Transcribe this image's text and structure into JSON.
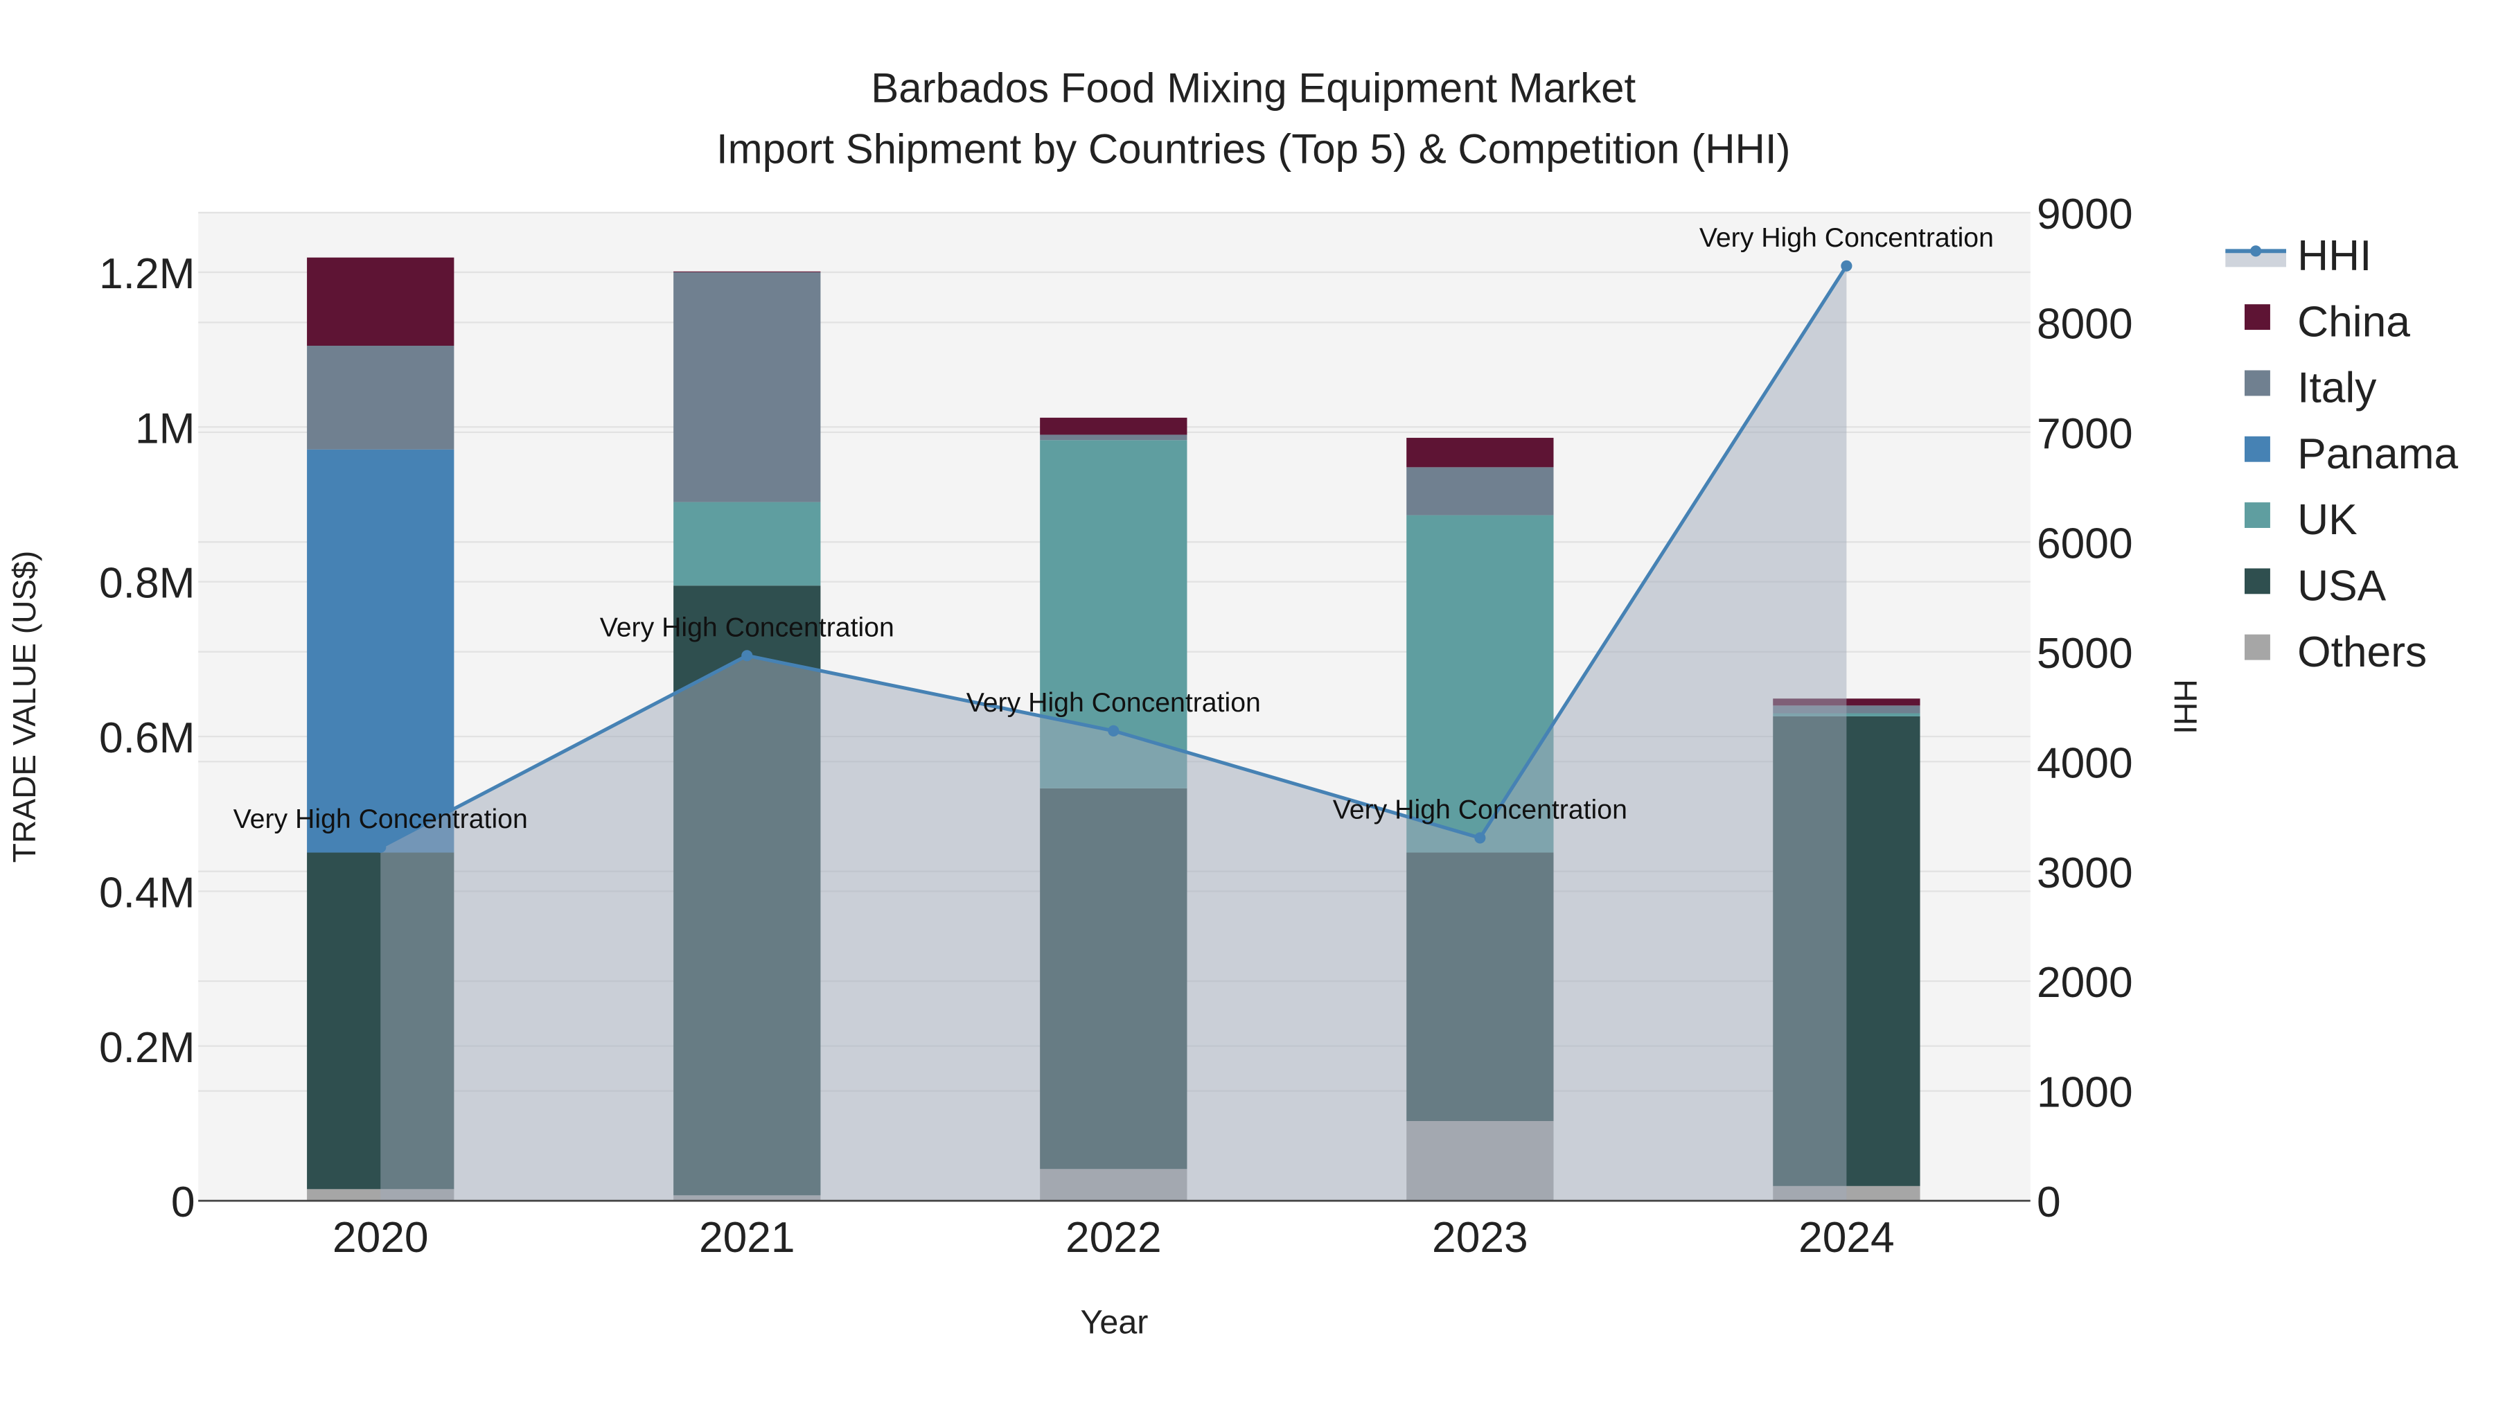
{
  "chart_data": {
    "type": "bar",
    "stacked": true,
    "title": "Barbados Food Mixing Equipment Market",
    "subtitle": "Import Shipment by Countries (Top 5) & Competition (HHI)",
    "xlabel": "Year",
    "ylabel": "TRADE VALUE (US$)",
    "y2label": "HHI",
    "categories": [
      "2020",
      "2021",
      "2022",
      "2023",
      "2024"
    ],
    "ylim": [
      0,
      1277000
    ],
    "y2lim": [
      0,
      9000
    ],
    "yticks": [
      0,
      200000,
      400000,
      600000,
      800000,
      1000000,
      1200000
    ],
    "ytick_labels": [
      "0",
      "0.2M",
      "0.4M",
      "0.6M",
      "0.8M",
      "1M",
      "1.2M"
    ],
    "y2ticks": [
      0,
      1000,
      2000,
      3000,
      4000,
      5000,
      6000,
      7000,
      8000,
      9000
    ],
    "y2tick_labels": [
      "0",
      "1000",
      "2000",
      "3000",
      "4000",
      "5000",
      "6000",
      "7000",
      "8000",
      "9000"
    ],
    "grid": true,
    "legend_position": "right",
    "series": [
      {
        "name": "Others",
        "color": "#a6a6a6",
        "values": [
          15000,
          7000,
          41000,
          103000,
          19000
        ]
      },
      {
        "name": "USA",
        "color": "#2f4f4f",
        "values": [
          435000,
          788000,
          492000,
          347000,
          607000
        ]
      },
      {
        "name": "UK",
        "color": "#5f9ea0",
        "values": [
          0,
          108000,
          450000,
          436000,
          4000
        ]
      },
      {
        "name": "Panama",
        "color": "#4682b4",
        "values": [
          521000,
          0,
          0,
          0,
          0
        ]
      },
      {
        "name": "Italy",
        "color": "#708090",
        "values": [
          134000,
          297000,
          7000,
          62000,
          10000
        ]
      },
      {
        "name": "China",
        "color": "#5e1434",
        "values": [
          114000,
          1000,
          22000,
          38000,
          9000
        ]
      }
    ],
    "hhi": {
      "name": "HHI",
      "color": "#4682b4",
      "values": [
        3220,
        4965,
        4280,
        3305,
        8515
      ],
      "annotations": [
        "Very High Concentration",
        "Very High Concentration",
        "Very High Concentration",
        "Very High Concentration",
        "Very High Concentration"
      ]
    },
    "legend_order": [
      "HHI",
      "China",
      "Italy",
      "Panama",
      "UK",
      "USA",
      "Others"
    ]
  }
}
